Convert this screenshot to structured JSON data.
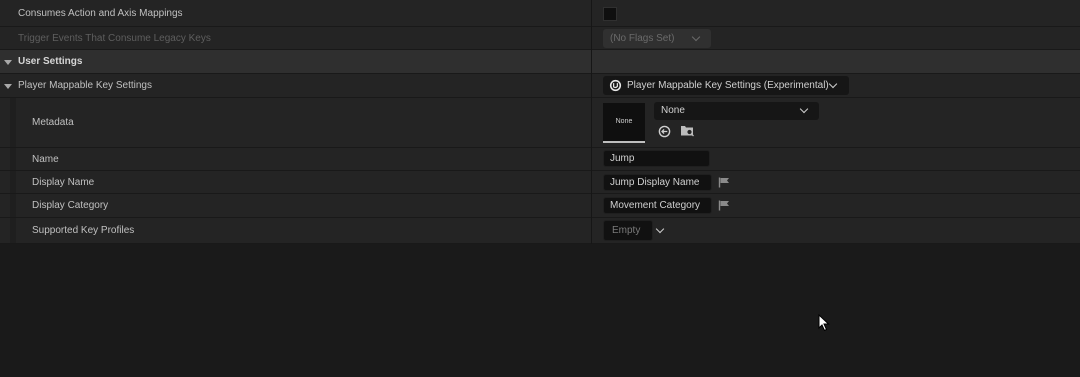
{
  "rows": {
    "consumes": {
      "label": "Consumes Action and Axis Mappings"
    },
    "trigger": {
      "label": "Trigger Events That Consume Legacy Keys",
      "value": "(No Flags Set)"
    },
    "user_settings": {
      "label": "User Settings"
    },
    "pmk": {
      "label": "Player Mappable Key Settings",
      "value": "Player Mappable Key Settings (Experimental)"
    },
    "metadata": {
      "label": "Metadata",
      "thumbnail": "None",
      "asset": "None"
    },
    "name": {
      "label": "Name",
      "value": "Jump"
    },
    "display_name": {
      "label": "Display Name",
      "value": "Jump Display Name"
    },
    "display_category": {
      "label": "Display Category",
      "value": "Movement Category"
    },
    "key_profiles": {
      "label": "Supported Key Profiles",
      "value": "Empty"
    }
  },
  "icons": {
    "pmk_class": "unreal-logo-icon",
    "use_selected": "arrow-left-circle-icon",
    "browse": "folder-browse-icon",
    "localize": "flag-icon",
    "collapse": "triangle-down-icon",
    "dropdown": "chevron-down-icon",
    "pointer": "mouse-cursor-icon"
  },
  "colors": {
    "background": "#1a1a1a",
    "row": "#242424",
    "section": "#2f2f2f",
    "field": "#111111",
    "text": "#c0c0c0"
  }
}
